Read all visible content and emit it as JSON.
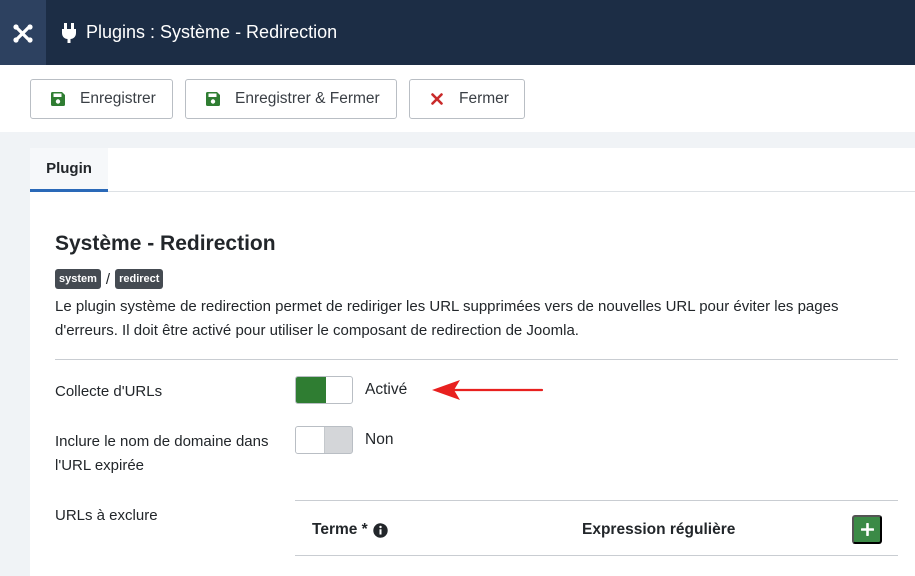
{
  "header": {
    "logo_icon": "joomla-logo-icon",
    "title_icon": "plug-icon",
    "title": "Plugins : Système - Redirection"
  },
  "toolbar": {
    "save_label": "Enregistrer",
    "save_close_label": "Enregistrer & Fermer",
    "close_label": "Fermer"
  },
  "tabs": [
    {
      "label": "Plugin",
      "active": true
    }
  ],
  "plugin": {
    "title": "Système - Redirection",
    "tags": [
      "system",
      "redirect"
    ],
    "tag_separator": "/",
    "description": "Le plugin système de redirection permet de rediriger les URL supprimées vers de nouvelles URL pour éviter les pages d'erreurs. Il doit être activé pour utiliser le composant de redirection de Joomla."
  },
  "fields": {
    "collect_urls": {
      "label": "Collecte d'URLs",
      "value": "Activé"
    },
    "include_domain": {
      "label": "Inclure le nom de domaine dans l'URL expirée",
      "value": "Non"
    },
    "exclude_urls": {
      "label": "URLs à exclure"
    }
  },
  "exclude_table": {
    "col_term": "Terme *",
    "col_regex": "Expression régulière"
  },
  "colors": {
    "header_bg": "#1c2d45",
    "switch_on": "#2f7d32",
    "add_button": "#3b8a46",
    "annotation_arrow": "#e8201f"
  }
}
